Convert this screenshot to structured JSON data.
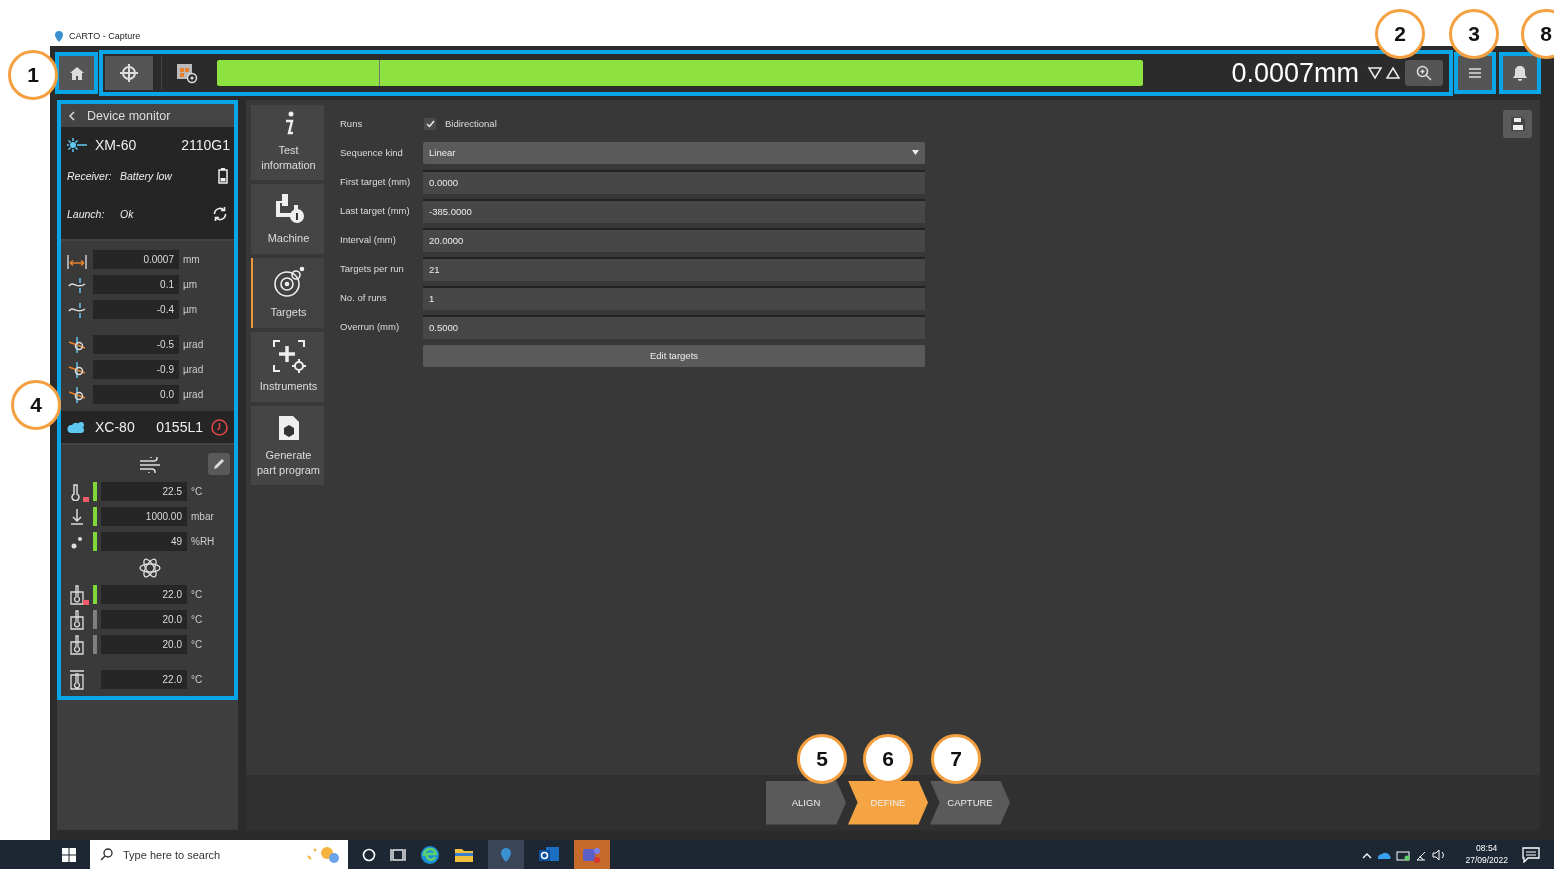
{
  "window": {
    "title": "CARTO - Capture"
  },
  "toolbar": {
    "readout": "0.0007mm"
  },
  "device_monitor": {
    "title": "Device monitor",
    "laser": {
      "model": "XM-60",
      "serial": "2110G1",
      "receiver_label": "Receiver:",
      "receiver_value": "Battery low",
      "launch_label": "Launch:",
      "launch_value": "Ok"
    },
    "laser_readings": [
      {
        "kind": "linear",
        "value": "0.0007",
        "unit": "mm"
      },
      {
        "kind": "straightness",
        "value": "0.1",
        "unit": "µm"
      },
      {
        "kind": "straightness",
        "value": "-0.4",
        "unit": "µm"
      },
      {
        "kind": "angular",
        "value": "-0.5",
        "unit": "µrad"
      },
      {
        "kind": "angular",
        "value": "-0.9",
        "unit": "µrad"
      },
      {
        "kind": "angular",
        "value": "0.0",
        "unit": "µrad"
      }
    ],
    "sensor": {
      "model": "XC-80",
      "serial": "0155L1"
    },
    "air_readings": [
      {
        "kind": "temperature",
        "value": "22.5",
        "unit": "°C",
        "active": true,
        "alarm": true
      },
      {
        "kind": "pressure",
        "value": "1000.00",
        "unit": "mbar",
        "active": true,
        "alarm": false
      },
      {
        "kind": "humidity",
        "value": "49",
        "unit": "%RH",
        "active": true,
        "alarm": false
      }
    ],
    "material_readings": [
      {
        "kind": "sensor",
        "value": "22.0",
        "unit": "°C",
        "active": true,
        "alarm": true
      },
      {
        "kind": "sensor",
        "value": "20.0",
        "unit": "°C",
        "active": false,
        "alarm": false
      },
      {
        "kind": "sensor",
        "value": "20.0",
        "unit": "°C",
        "active": false,
        "alarm": false
      },
      {
        "kind": "average",
        "value": "22.0",
        "unit": "°C",
        "alarm": false
      }
    ]
  },
  "nav": [
    {
      "kind": "info",
      "label": "Test information",
      "selected": false
    },
    {
      "kind": "machine",
      "label": "Machine",
      "selected": false
    },
    {
      "kind": "targets",
      "label": "Targets",
      "selected": true
    },
    {
      "kind": "instruments",
      "label": "Instruments",
      "selected": false
    },
    {
      "kind": "program",
      "label": "Generate part program",
      "selected": false
    }
  ],
  "form": {
    "runs_label": "Runs",
    "bidirectional": {
      "label": "Bidirectional",
      "checked": true
    },
    "fields": [
      {
        "kind": "dropdown",
        "label": "Sequence kind",
        "value": "Linear"
      },
      {
        "kind": "text",
        "label": "First target (mm)",
        "value": "0.0000"
      },
      {
        "kind": "text",
        "label": "Last target (mm)",
        "value": "-385.0000"
      },
      {
        "kind": "text",
        "label": "Interval (mm)",
        "value": "20.0000"
      },
      {
        "kind": "text",
        "label": "Targets per run",
        "value": "21"
      },
      {
        "kind": "text",
        "label": "No. of runs",
        "value": "1"
      },
      {
        "kind": "text",
        "label": "Overrun (mm)",
        "value": "0.5000"
      }
    ],
    "button": "Edit targets"
  },
  "steps": [
    {
      "label": "ALIGN",
      "selected": false
    },
    {
      "label": "DEFINE",
      "selected": true
    },
    {
      "label": "CAPTURE",
      "selected": false
    }
  ],
  "callouts": [
    "1",
    "2",
    "3",
    "8",
    "4",
    "5",
    "6",
    "7"
  ],
  "taskbar": {
    "search_placeholder": "Type here to search",
    "time": "08:54",
    "date": "27/09/2022"
  }
}
